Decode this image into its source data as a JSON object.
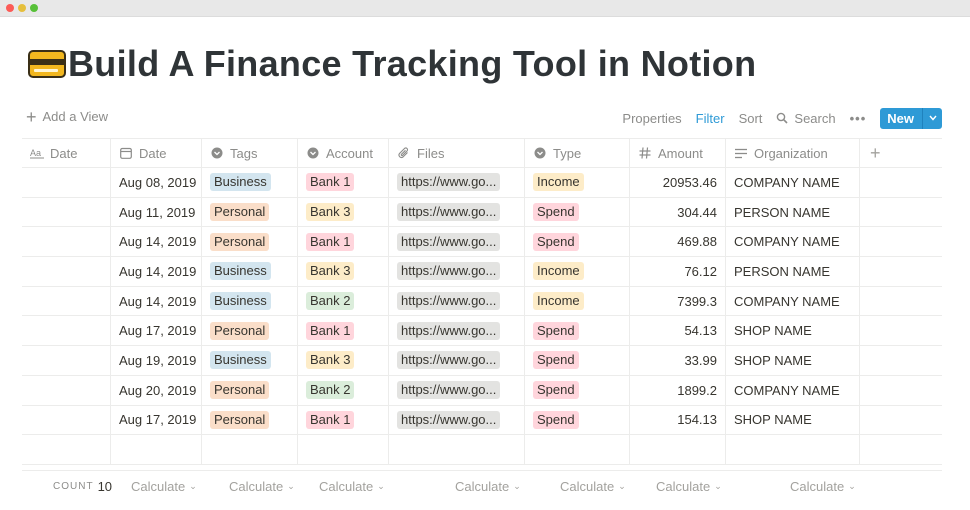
{
  "page": {
    "title": "Build A Finance Tracking Tool in Notion"
  },
  "toolbar": {
    "add_view": "Add a View",
    "properties": "Properties",
    "filter": "Filter",
    "sort": "Sort",
    "search": "Search",
    "more": "•••",
    "new": "New"
  },
  "columns": [
    "Date",
    "Date",
    "Tags",
    "Account",
    "Files",
    "Type",
    "Amount",
    "Organization"
  ],
  "rows": [
    {
      "date": "Aug 08, 2019",
      "tag": "Business",
      "account": "Bank 1",
      "file": "https://www.go...",
      "type": "Income",
      "amount": "20953.46",
      "org": "COMPANY NAME"
    },
    {
      "date": "Aug 11, 2019",
      "tag": "Personal",
      "account": "Bank 3",
      "file": "https://www.go...",
      "type": "Spend",
      "amount": "304.44",
      "org": "PERSON NAME"
    },
    {
      "date": "Aug 14, 2019",
      "tag": "Personal",
      "account": "Bank 1",
      "file": "https://www.go...",
      "type": "Spend",
      "amount": "469.88",
      "org": "COMPANY NAME"
    },
    {
      "date": "Aug 14, 2019",
      "tag": "Business",
      "account": "Bank 3",
      "file": "https://www.go...",
      "type": "Income",
      "amount": "76.12",
      "org": "PERSON NAME"
    },
    {
      "date": "Aug 14, 2019",
      "tag": "Business",
      "account": "Bank 2",
      "file": "https://www.go...",
      "type": "Income",
      "amount": "7399.3",
      "org": "COMPANY NAME"
    },
    {
      "date": "Aug 17, 2019",
      "tag": "Personal",
      "account": "Bank 1",
      "file": "https://www.go...",
      "type": "Spend",
      "amount": "54.13",
      "org": "SHOP NAME"
    },
    {
      "date": "Aug 19, 2019",
      "tag": "Business",
      "account": "Bank 3",
      "file": "https://www.go...",
      "type": "Spend",
      "amount": "33.99",
      "org": "SHOP NAME"
    },
    {
      "date": "Aug 20, 2019",
      "tag": "Personal",
      "account": "Bank 2",
      "file": "https://www.go...",
      "type": "Spend",
      "amount": "1899.2",
      "org": "COMPANY NAME"
    },
    {
      "date": "Aug 17, 2019",
      "tag": "Personal",
      "account": "Bank 1",
      "file": "https://www.go...",
      "type": "Spend",
      "amount": "154.13",
      "org": "SHOP NAME"
    }
  ],
  "footer": {
    "count_label": "COUNT",
    "count_value": "10",
    "calculate": "Calculate"
  },
  "colors": {
    "accent": "#2e9ad6",
    "business": "#d3e5ef",
    "personal": "#fadec9",
    "bank1": "#ffd5dc",
    "bank2": "#dbeddb",
    "bank3": "#fdecc8",
    "income": "#fdecc8",
    "spend": "#ffd5dc"
  },
  "icons": {
    "title": "credit-card-icon",
    "date_title": "text-icon",
    "date": "calendar-icon",
    "tags": "select-icon",
    "account": "select-icon",
    "files": "paperclip-icon",
    "type": "select-icon",
    "amount": "hash-icon",
    "organization": "lines-icon"
  }
}
